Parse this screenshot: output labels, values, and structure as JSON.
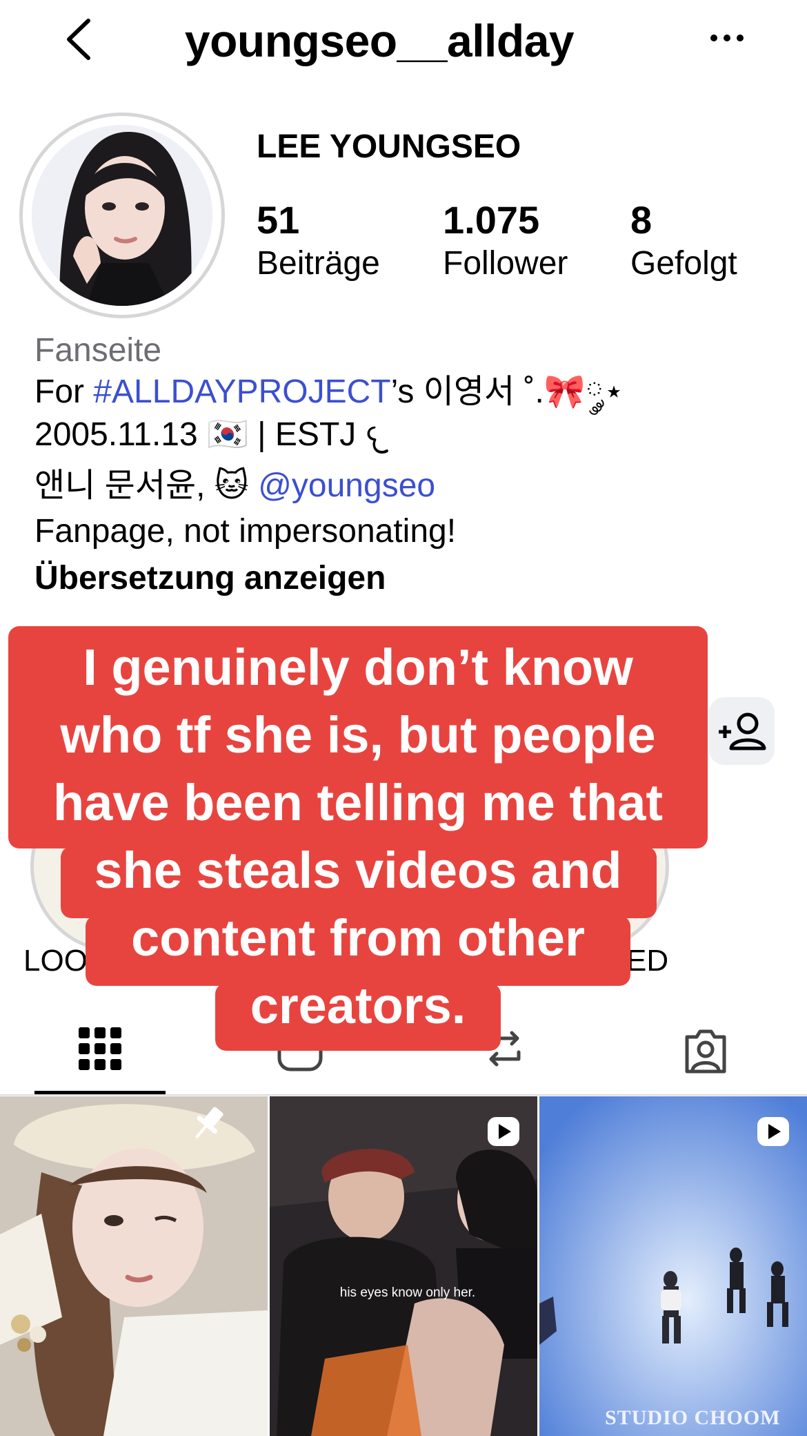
{
  "header": {
    "username": "youngseo__allday"
  },
  "profile": {
    "display_name": "LEE YOUNGSEO",
    "stats": [
      {
        "value": "51",
        "label": "Beiträge"
      },
      {
        "value": "1.075",
        "label": "Follower"
      },
      {
        "value": "8",
        "label": "Gefolgt"
      }
    ],
    "category": "Fanseite",
    "bio": {
      "line1_prefix": "For ",
      "line1_hashtag": "#ALLDAYPROJECT",
      "line1_suffix": "’s 이영서 ˚.🎀༘⋆",
      "line2": "2005.11.13 🇰🇷 | ESTJ 𐔌",
      "line3_prefix": "앤니 문서윤, 🐱 ",
      "line3_mention": "@youngseo",
      "line4": "Fanpage, not impersonating!",
      "translate": "Übersetzung anzeigen"
    }
  },
  "highlights": {
    "first_label_partial": "LOO",
    "last_label_partial": "ED"
  },
  "overlay": {
    "lines": [
      "I genuinely don’t know",
      "who tf she is, but people",
      "have been telling me that",
      "she steals videos and",
      "content from other",
      "creators."
    ]
  },
  "tabs": [
    "grid-icon",
    "reels-icon",
    "reposts-icon",
    "tagged-icon"
  ],
  "grid": {
    "tile2_caption": "his eyes know only her.",
    "tile3_watermark": "STUDIO CHOOM"
  },
  "colors": {
    "overlay": "#e8443f",
    "link": "#3b4fd1",
    "secondary_text": "#6d6d72"
  }
}
